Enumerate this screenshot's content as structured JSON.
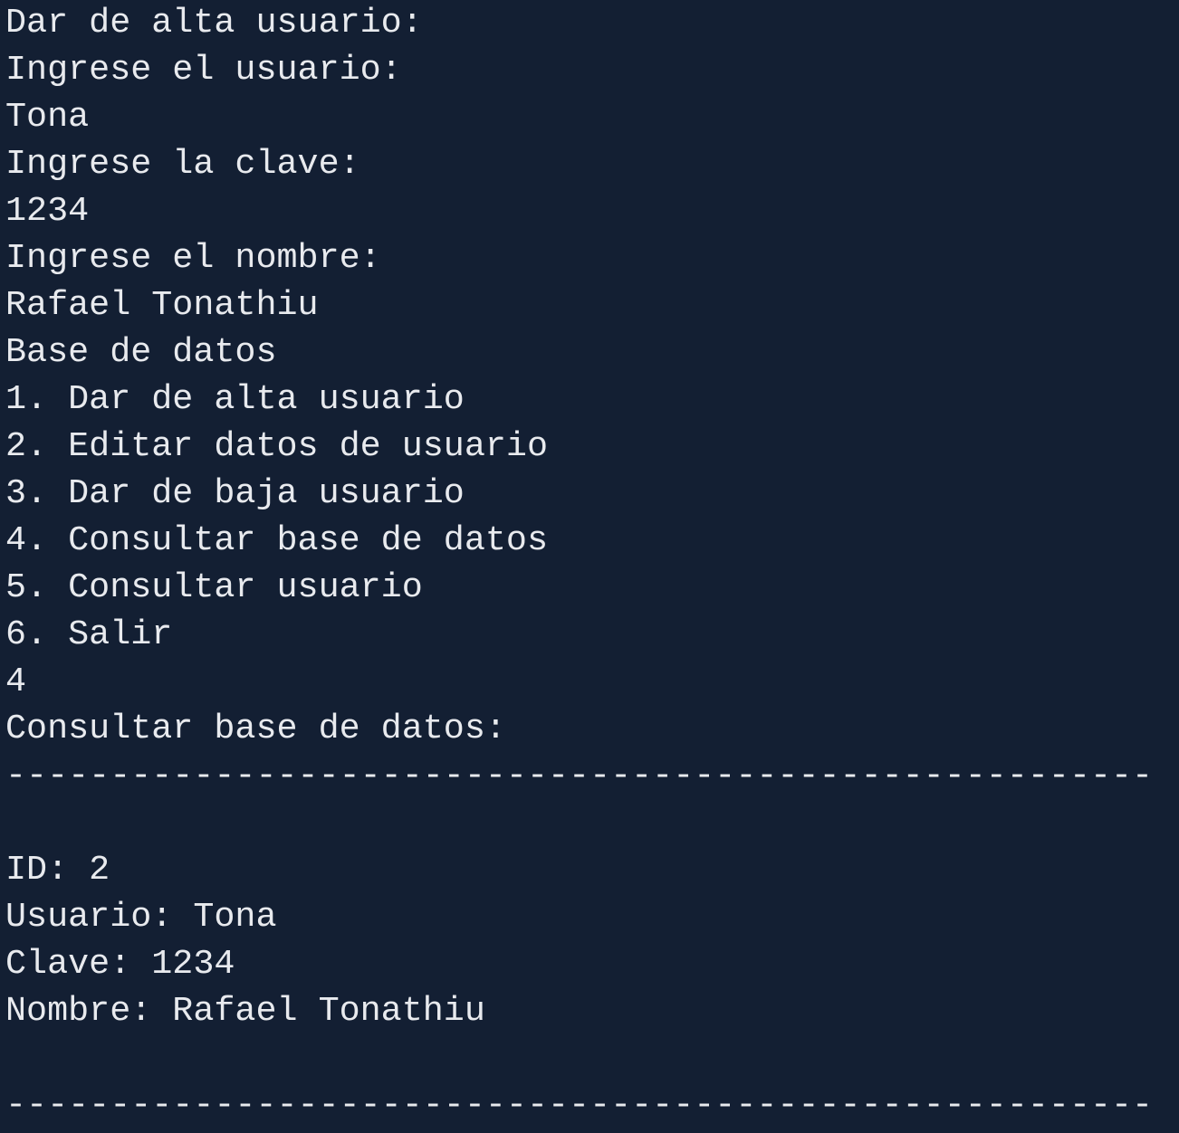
{
  "terminal": {
    "background": "#131f33",
    "foreground": "#e8eaee",
    "alta": {
      "header": "Dar de alta usuario:",
      "prompt_user": "Ingrese el usuario:",
      "input_user": "Tona",
      "prompt_key": "Ingrese la clave:",
      "input_key": "1234",
      "prompt_name": "Ingrese el nombre:",
      "input_name": "Rafael Tonathiu"
    },
    "menu": {
      "title": "Base de datos",
      "items": [
        "1. Dar de alta usuario",
        "2. Editar datos de usuario",
        "3. Dar de baja usuario",
        "4. Consultar base de datos",
        "5. Consultar usuario",
        "6. Salir"
      ],
      "selection": "4"
    },
    "query": {
      "header": "Consultar base de datos:",
      "separator": "-------------------------------------------------------",
      "record": {
        "id": "ID: 2",
        "user": "Usuario: Tona",
        "key": "Clave: 1234",
        "name": "Nombre: Rafael Tonathiu"
      },
      "separator_end": "-------------------------------------------------------"
    }
  }
}
